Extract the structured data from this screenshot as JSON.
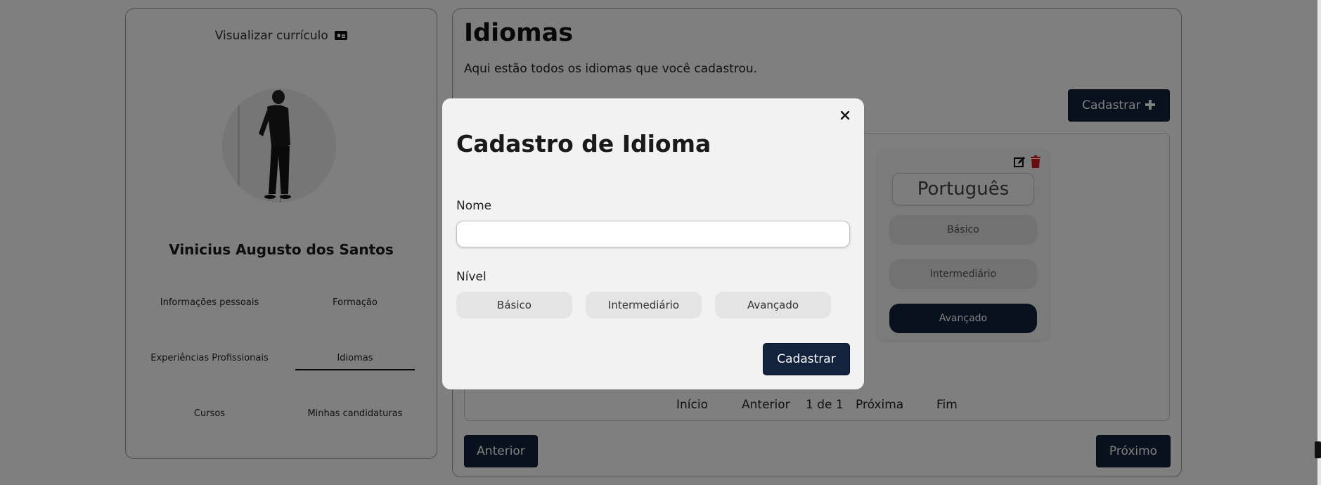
{
  "profile": {
    "view_cv": "Visualizar currículo",
    "user_name": "Vinicius Augusto dos Santos",
    "nav": {
      "personal_info": "Informações pessoais",
      "education": "Formação",
      "experience": "Experiências Profissionais",
      "languages": "Idiomas",
      "courses": "Cursos",
      "applications": "Minhas candidaturas"
    }
  },
  "main": {
    "title": "Idiomas",
    "subtitle": "Aqui estão todos os idiomas que você cadastrou.",
    "register_button": "Cadastrar",
    "language_card": {
      "name": "Português",
      "levels": [
        "Básico",
        "Intermediário",
        "Avançado"
      ],
      "selected_level": "Avançado"
    },
    "pagination": {
      "first": "Início",
      "previous": "Anterior",
      "page_info": "1 de 1",
      "next": "Próxima",
      "last": "Fim"
    },
    "prev_button": "Anterior",
    "next_button": "Próximo"
  },
  "modal": {
    "title": "Cadastro de Idioma",
    "name_label": "Nome",
    "name_value": "",
    "level_label": "Nível",
    "levels": [
      "Básico",
      "Intermediário",
      "Avançado"
    ],
    "submit_button": "Cadastrar",
    "close_symbol": "×"
  },
  "colors": {
    "primary_dark": "#13223d",
    "delete_red": "#d11a1a",
    "overlay": "rgba(0,0,0,0.5)",
    "modal_bg": "#f2f2f2"
  },
  "icons": [
    "id-card-icon",
    "plus-icon",
    "edit-icon",
    "trash-icon",
    "close-icon"
  ]
}
